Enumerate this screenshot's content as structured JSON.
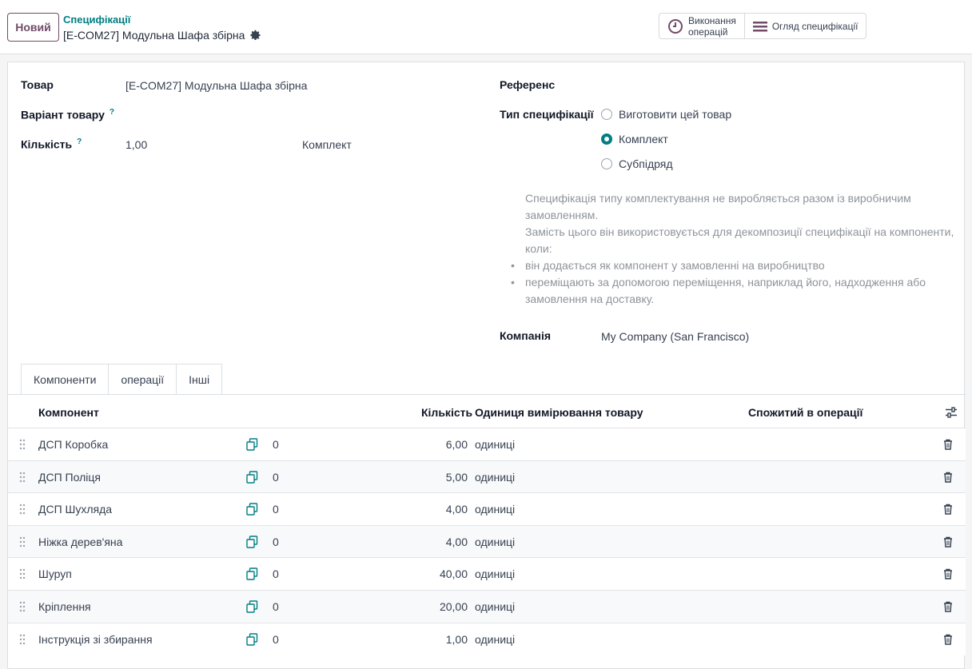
{
  "header": {
    "new_button": "Новий",
    "breadcrumb": "Специфікації",
    "record_title": "[E-COM27] Модульна Шафа збірна",
    "smart_buttons": [
      {
        "line1": "Виконання",
        "line2": "операцій",
        "icon": "clock-icon"
      },
      {
        "label": "Огляд специфікації",
        "icon": "bars-icon"
      }
    ]
  },
  "form": {
    "product_label": "Товар",
    "product_value": "[E-COM27] Модульна Шафа збірна",
    "variant_label": "Варіант товару",
    "quantity_label": "Кількість",
    "quantity_value": "1,00",
    "quantity_uom": "Комплект",
    "help_mark": "?",
    "reference_label": "Референс",
    "bom_type_label": "Тип специфікації",
    "bom_type_options": [
      {
        "label": "Виготовити цей товар",
        "selected": false
      },
      {
        "label": "Комплект",
        "selected": true
      },
      {
        "label": "Субпідряд",
        "selected": false
      }
    ],
    "note_p1": "Специфікація типу комплектування не виробляється разом із виробничим замовленням.",
    "note_p2": "Замість цього він використовується для декомпозиції специфікації на компоненти, коли:",
    "note_bullets": [
      "він додається як компонент у замовленні на виробництво",
      "переміщають за допомогою переміщення, наприклад його, надходження або замовлення на доставку."
    ],
    "company_label": "Компанія",
    "company_value": "My Company (San Francisco)"
  },
  "tabs": [
    "Компоненти",
    "операції",
    "Інші"
  ],
  "table": {
    "headers": {
      "component": "Компонент",
      "quantity": "Кількість",
      "uom": "Одиниця вимірювання товару",
      "consumed": "Спожитий в операції"
    },
    "rows": [
      {
        "component": "ДСП Коробка",
        "count": "0",
        "qty": "6,00",
        "uom": "одиниці"
      },
      {
        "component": "ДСП Поліця",
        "count": "0",
        "qty": "5,00",
        "uom": "одиниці"
      },
      {
        "component": "ДСП Шухляда",
        "count": "0",
        "qty": "4,00",
        "uom": "одиниці"
      },
      {
        "component": "Ніжка дерев'яна",
        "count": "0",
        "qty": "4,00",
        "uom": "одиниці"
      },
      {
        "component": "Шуруп",
        "count": "0",
        "qty": "40,00",
        "uom": "одиниці"
      },
      {
        "component": "Кріплення",
        "count": "0",
        "qty": "20,00",
        "uom": "одиниці"
      },
      {
        "component": "Інструкція зі збирання",
        "count": "0",
        "qty": "1,00",
        "uom": "одиниці"
      }
    ]
  },
  "colors": {
    "brand": "#714b67",
    "accent": "#017e84"
  }
}
